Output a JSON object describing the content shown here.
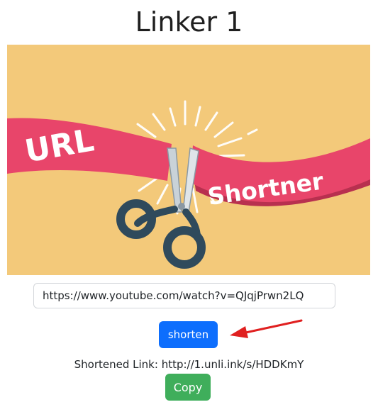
{
  "header": {
    "title": "Linker 1"
  },
  "banner": {
    "word_1": "URL",
    "word_2": "Shortner",
    "colors": {
      "background": "#f3c97a",
      "ribbon": "#e8456a",
      "ribbon_shadow": "#b8304f",
      "scissors_handle": "#2f4a5c",
      "blade": "#c9d2d8"
    },
    "icon": "scissors-icon"
  },
  "form": {
    "url_value": "https://www.youtube.com/watch?v=QJqjPrwn2LQ",
    "shorten_label": "shorten"
  },
  "result": {
    "text": "Shortened Link: http://1.unli.ink/s/HDDKmY",
    "copy_label": "Copy"
  },
  "annotation": {
    "arrow_color": "#e02020"
  },
  "colors": {
    "primary_button": "#0d6efd",
    "success_button": "#3fae5b"
  }
}
